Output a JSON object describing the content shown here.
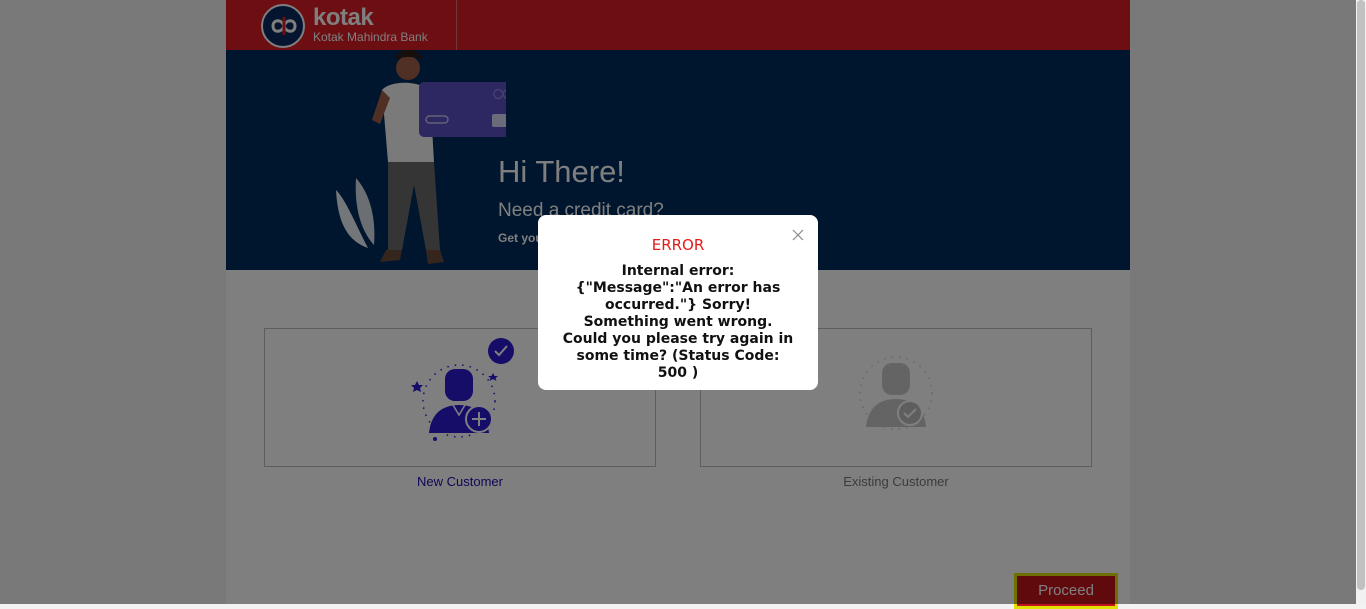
{
  "header": {
    "brand_name": "kotak",
    "brand_sub": "Kotak Mahindra Bank",
    "logo_icon": "kotak-infinity-logo"
  },
  "hero": {
    "title": "Hi There!",
    "subtitle": "Need a credit card?",
    "small_text": "Get your"
  },
  "cards": [
    {
      "label": "New Customer",
      "icon": "new-user-plus-icon",
      "selected": true
    },
    {
      "label": "Existing Customer",
      "icon": "existing-user-check-icon",
      "selected": false
    }
  ],
  "proceed_label": "Proceed",
  "modal": {
    "title": "ERROR",
    "message": "Internal error: {\"Message\":\"An error has occurred.\"} Sorry! Something went wrong. Could you please try again in some time? (Status Code: 500 )",
    "close_icon": "close-icon"
  },
  "colors": {
    "brand_red": "#d91d24",
    "hero_navy": "#002b5c",
    "error_red": "#e31b1b",
    "accent_blue": "#2a1bd1"
  }
}
